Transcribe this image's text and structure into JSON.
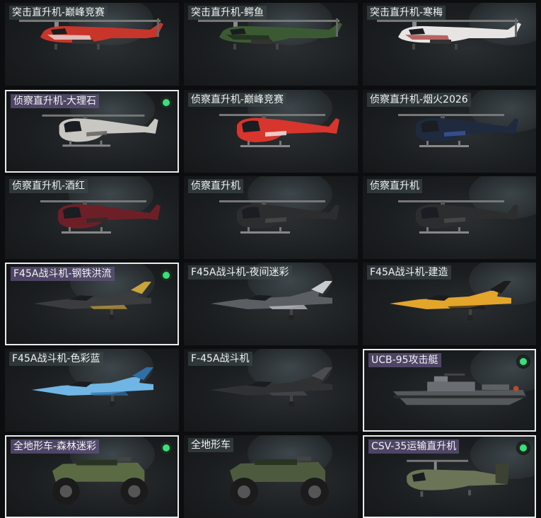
{
  "colors": {
    "selected_border": "#e9ecec",
    "selected_label_bg": "#5c5078",
    "owned_badge": "#36e27a"
  },
  "cards": [
    {
      "label": "突击直升机-巅峰竞赛",
      "selected": false,
      "owned": false,
      "vehicle": "attack-helicopter",
      "color": "#c8352a",
      "accent": "#e8e8e8"
    },
    {
      "label": "突击直升机-鳄鱼",
      "selected": false,
      "owned": false,
      "vehicle": "attack-helicopter",
      "color": "#3b5a33",
      "accent": "#1e2a1c"
    },
    {
      "label": "突击直升机-寒梅",
      "selected": false,
      "owned": false,
      "vehicle": "attack-helicopter",
      "color": "#e7e5e3",
      "accent": "#a63a3a"
    },
    {
      "label": "侦察直升机-大理石",
      "selected": true,
      "owned": true,
      "vehicle": "scout-helicopter",
      "color": "#c9c7c2",
      "accent": "#5c5c5c"
    },
    {
      "label": "侦察直升机-巅峰竞赛",
      "selected": false,
      "owned": false,
      "vehicle": "scout-helicopter",
      "color": "#d8352d",
      "accent": "#f1f1f1"
    },
    {
      "label": "侦察直升机-烟火2026",
      "selected": false,
      "owned": false,
      "vehicle": "scout-helicopter",
      "color": "#1f2a3f",
      "accent": "#3a56a0"
    },
    {
      "label": "侦察直升机-酒红",
      "selected": false,
      "owned": false,
      "vehicle": "scout-helicopter",
      "color": "#6d1f28",
      "accent": "#2a2a2a"
    },
    {
      "label": "侦察直升机",
      "selected": false,
      "owned": false,
      "vehicle": "scout-helicopter",
      "color": "#2b2d2f",
      "accent": "#4a4c4e"
    },
    {
      "label": "侦察直升机",
      "selected": false,
      "owned": false,
      "vehicle": "scout-helicopter",
      "color": "#2b2d2f",
      "accent": "#4a4c4e"
    },
    {
      "label": "F45A战斗机-钢铁洪流",
      "selected": true,
      "owned": true,
      "vehicle": "fighter-jet",
      "color": "#3a3c3e",
      "accent": "#c9a43a"
    },
    {
      "label": "F45A战斗机-夜间迷彩",
      "selected": false,
      "owned": false,
      "vehicle": "fighter-jet",
      "color": "#5b5f63",
      "accent": "#c8ccd0"
    },
    {
      "label": "F45A战斗机-建造",
      "selected": false,
      "owned": false,
      "vehicle": "fighter-jet",
      "color": "#e3a52a",
      "accent": "#1c1c1c"
    },
    {
      "label": "F45A战斗机-色彩蓝",
      "selected": false,
      "owned": false,
      "vehicle": "fighter-jet",
      "color": "#6fb6e6",
      "accent": "#2f6fa6"
    },
    {
      "label": "F-45A战斗机",
      "selected": false,
      "owned": false,
      "vehicle": "fighter-jet",
      "color": "#2f3133",
      "accent": "#4a4c4e"
    },
    {
      "label": "UCB-95攻击艇",
      "selected": true,
      "owned": true,
      "vehicle": "attack-boat",
      "color": "#55595c",
      "accent": "#2a2c2e"
    },
    {
      "label": "全地形车-森林迷彩",
      "selected": true,
      "owned": true,
      "vehicle": "atv",
      "color": "#5a6a43",
      "accent": "#2a3322"
    },
    {
      "label": "全地形车",
      "selected": false,
      "owned": false,
      "vehicle": "atv",
      "color": "#4e5a3e",
      "accent": "#2a3322"
    },
    {
      "label": "CSV-35运输直升机",
      "selected": true,
      "owned": true,
      "vehicle": "transport-helicopter",
      "color": "#6b7457",
      "accent": "#3c4232"
    }
  ]
}
